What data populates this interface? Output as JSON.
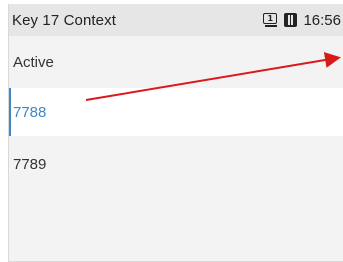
{
  "statusbar": {
    "title": "Key 17 Context",
    "time": "16:56",
    "icons": [
      "line-1-icon",
      "phone-icon"
    ]
  },
  "header": {
    "label": "Active"
  },
  "list": {
    "items": [
      {
        "label": "7788",
        "selected": true
      },
      {
        "label": "7789",
        "selected": false
      }
    ]
  },
  "colors": {
    "selected_text": "#3f86c5",
    "arrow": "#d91a1a",
    "statusbar_bg": "#e6e6e6",
    "screen_bg": "#f3f3f3"
  }
}
